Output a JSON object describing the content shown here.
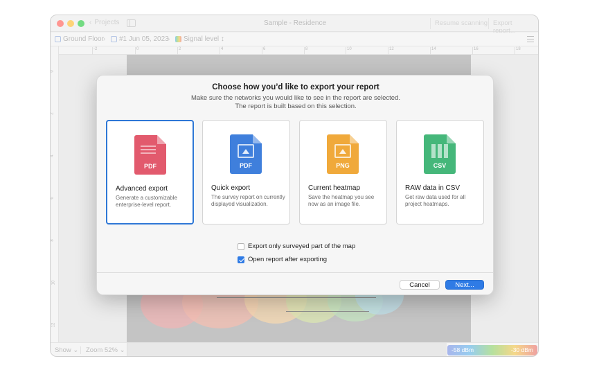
{
  "window": {
    "title": "Sample - Residence",
    "back_label": "Projects",
    "toolbar": {
      "resume_label": "Resume scanning",
      "export_label": "Export report..."
    }
  },
  "pathbar": {
    "floor": "Ground Floor",
    "survey": "#1 Jun 05, 2023",
    "visualization": "Signal level ↕"
  },
  "ruler": {
    "h_ticks": [
      "-2",
      "0",
      "2",
      "4",
      "6",
      "8",
      "10",
      "12",
      "14",
      "16",
      "18"
    ],
    "v_ticks": [
      "0",
      "2",
      "4",
      "6",
      "8",
      "10",
      "12"
    ]
  },
  "statusbar": {
    "show_label": "Show ⌄",
    "zoom_label": "Zoom 52% ⌄",
    "legend_min": "-58 dBm",
    "legend_max": "-30 dBm"
  },
  "dialog": {
    "title": "Choose how you’d like to export your report",
    "subtitle_line1": "Make sure the networks you would like to see in the report are selected.",
    "subtitle_line2": "The report is built based on this selection.",
    "options": [
      {
        "badge": "PDF",
        "title": "Advanced export",
        "desc": "Generate a customizable enterprise-level report.",
        "color": "#e25a6d",
        "selected": true
      },
      {
        "badge": "PDF",
        "title": "Quick export",
        "desc": "The survey report on currently displayed visualization.",
        "color": "#3f7fdc",
        "selected": false
      },
      {
        "badge": "PNG",
        "title": "Current heatmap",
        "desc": "Save the heatmap you see now as an image file.",
        "color": "#f0a93b",
        "selected": false
      },
      {
        "badge": "CSV",
        "title": "RAW data in CSV",
        "desc": "Get raw data used for all project heatmaps.",
        "color": "#45b77a",
        "selected": false
      }
    ],
    "checkboxes": [
      {
        "label": "Export only surveyed part of the map",
        "checked": false
      },
      {
        "label": "Open report after exporting",
        "checked": true
      }
    ],
    "cancel_label": "Cancel",
    "next_label": "Next..."
  }
}
